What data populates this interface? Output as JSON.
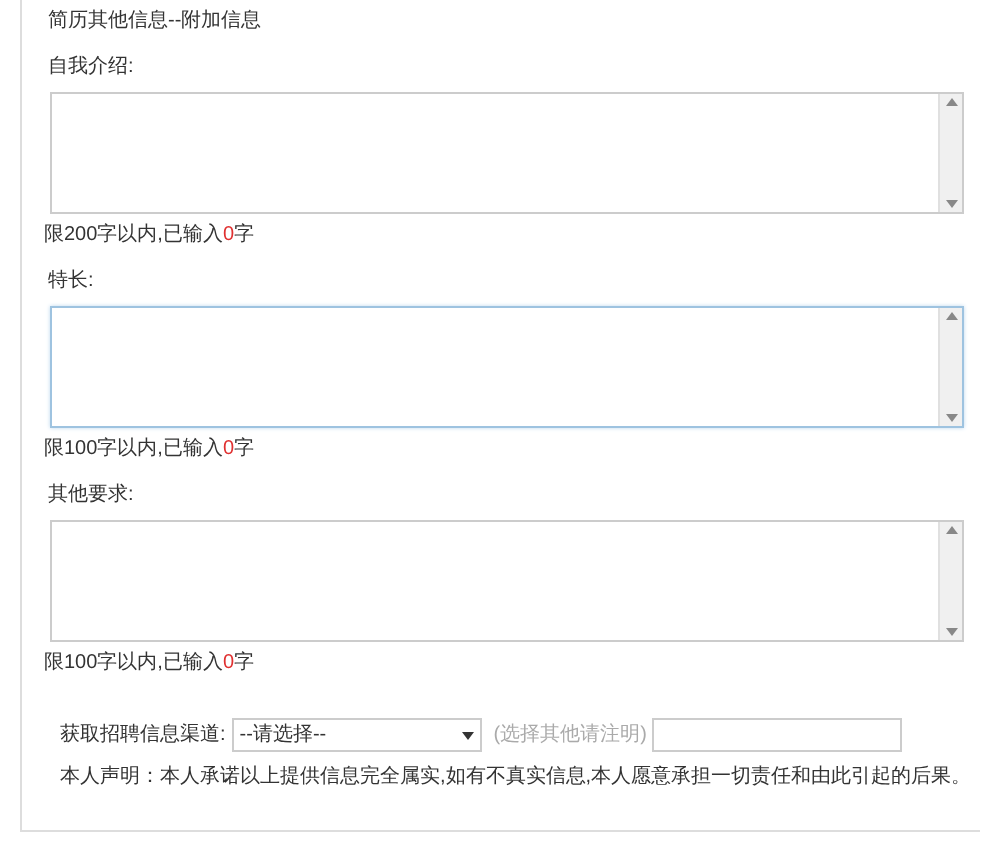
{
  "section_title": "简历其他信息--附加信息",
  "fields": [
    {
      "label": "自我介绍:",
      "focused": false,
      "counter": {
        "prefix": "限200字以内,已输入",
        "count": "0",
        "suffix": "字"
      }
    },
    {
      "label": "特长:",
      "focused": true,
      "counter": {
        "prefix": "限100字以内,已输入",
        "count": "0",
        "suffix": "字"
      }
    },
    {
      "label": "其他要求:",
      "focused": false,
      "counter": {
        "prefix": "限100字以内,已输入",
        "count": "0",
        "suffix": "字"
      }
    }
  ],
  "channel": {
    "label": "获取招聘信息渠道:",
    "select_value": "--请选择--",
    "hint": "(选择其他请注明)"
  },
  "declaration": "本人声明：本人承诺以上提供信息完全属实,如有不真实信息,本人愿意承担一切责任和由此引起的后果。"
}
